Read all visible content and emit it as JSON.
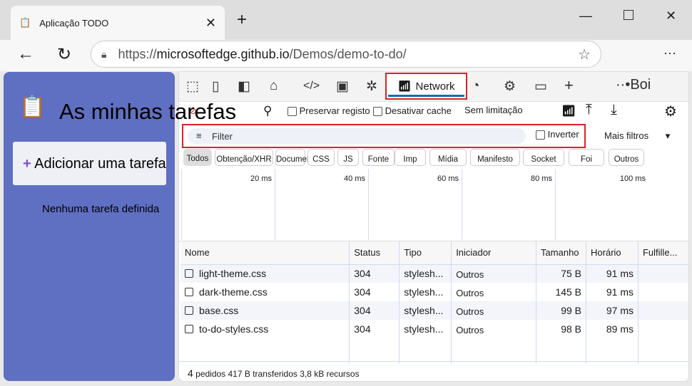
{
  "browser": {
    "tab_title": "Aplicação TODO",
    "url_prefix": "https://",
    "url_host": "microsoftedge.github.io",
    "url_path": "/Demos/demo-to-do/"
  },
  "app": {
    "title": "As minhas tarefas",
    "add_task": "Adicionar uma tarefa",
    "empty": "Nenhuma tarefa definida"
  },
  "devtools": {
    "active_tab": "Network",
    "more_label": "Boi",
    "preserve_log": "Preservar registo",
    "disable_cache": "Desativar cache",
    "throttling": "Sem limitação",
    "filter_placeholder": "Filter",
    "invert": "Inverter",
    "more_filters": "Mais filtros",
    "chips": [
      "Todos",
      "Obtenção/XHR",
      "Documento",
      "CSS",
      "JS",
      "Fonte",
      "Imp",
      "Mídia",
      "Manifesto",
      "Socket",
      "Foi",
      "Outros"
    ],
    "ticks": [
      "20 ms",
      "40 ms",
      "60 ms",
      "80 ms",
      "100 ms"
    ],
    "columns": [
      "Nome",
      "Status",
      "Tipo",
      "Iniciador",
      "Tamanho",
      "Horário",
      "Fulfille..."
    ],
    "rows": [
      {
        "name": "light-theme.css",
        "status": "304",
        "type": "stylesh...",
        "initiator": "Outros",
        "size": "75 B",
        "time": "91 ms"
      },
      {
        "name": "dark-theme.css",
        "status": "304",
        "type": "stylesh...",
        "initiator": "Outros",
        "size": "145 B",
        "time": "91 ms"
      },
      {
        "name": "base.css",
        "status": "304",
        "type": "stylesh...",
        "initiator": "Outros",
        "size": "99 B",
        "time": "97 ms"
      },
      {
        "name": "to-do-styles.css",
        "status": "304",
        "type": "stylesh...",
        "initiator": "Outros",
        "size": "98 B",
        "time": "89 ms"
      }
    ],
    "footer_count": "4",
    "footer_text": "pedidos 417 B transferidos 3,8 kB recursos"
  },
  "colors": {
    "page_bg": "#5f6fc1",
    "highlight": "#e0202a",
    "accent": "#0f6cbd"
  }
}
